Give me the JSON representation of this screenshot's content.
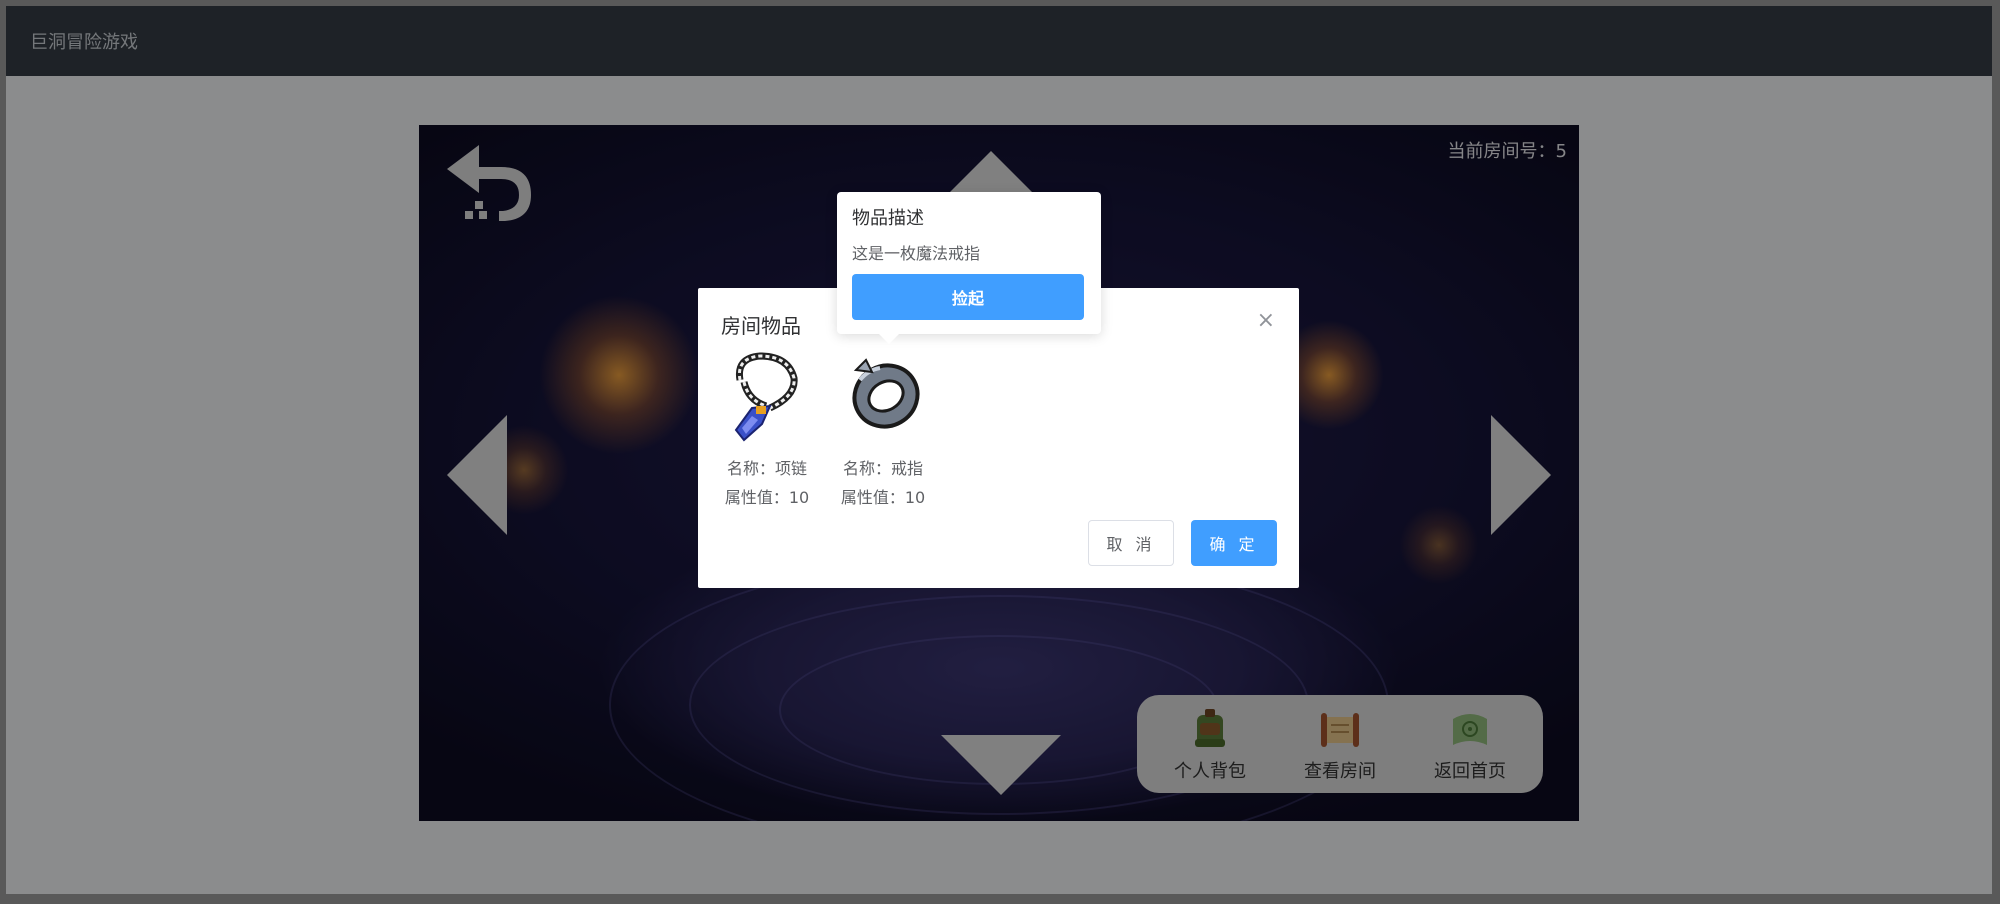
{
  "app": {
    "title": "巨洞冒险游戏"
  },
  "game": {
    "room_label": "当前房间号：5",
    "toolbar": [
      {
        "label": "个人背包",
        "icon": "backpack-icon"
      },
      {
        "label": "查看房间",
        "icon": "scroll-map-icon"
      },
      {
        "label": "返回首页",
        "icon": "home-scroll-icon"
      }
    ]
  },
  "modal": {
    "title": "房间物品",
    "close_glyph": "×",
    "items": [
      {
        "name": "名称：项链",
        "value": "属性值：10",
        "icon": "necklace-icon"
      },
      {
        "name": "名称：戒指",
        "value": "属性值：10",
        "icon": "ring-icon"
      }
    ],
    "cancel_label": "取 消",
    "ok_label": "确 定"
  },
  "popover": {
    "title": "物品描述",
    "description": "这是一枚魔法戒指",
    "pick_label": "捡起"
  }
}
